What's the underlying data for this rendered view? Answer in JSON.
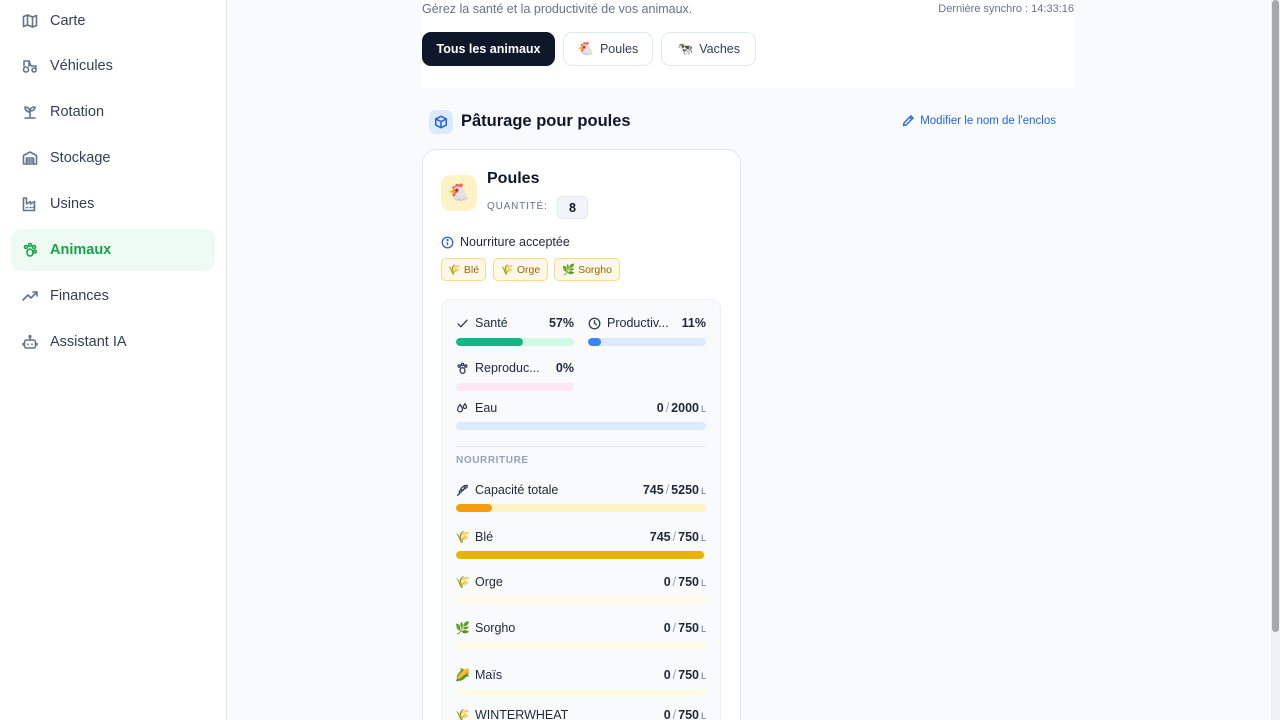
{
  "sidebar": {
    "items": [
      {
        "label": "Carte",
        "icon": "map-icon",
        "active": false
      },
      {
        "label": "Véhicules",
        "icon": "tractor-icon",
        "active": false
      },
      {
        "label": "Rotation",
        "icon": "sprout-icon",
        "active": false
      },
      {
        "label": "Stockage",
        "icon": "warehouse-icon",
        "active": false
      },
      {
        "label": "Usines",
        "icon": "factory-icon",
        "active": false
      },
      {
        "label": "Animaux",
        "icon": "paw-icon",
        "active": true
      },
      {
        "label": "Finances",
        "icon": "trending-up-icon",
        "active": false
      },
      {
        "label": "Assistant IA",
        "icon": "bot-icon",
        "active": false
      }
    ]
  },
  "header": {
    "subtitle": "Gérez la santé et la productivité de vos animaux.",
    "sync": "Dernière synchro : 14:33:16"
  },
  "filters": [
    {
      "label": "Tous les animaux",
      "emoji": "",
      "active": true
    },
    {
      "label": "Poules",
      "emoji": "🐔",
      "active": false
    },
    {
      "label": "Vaches",
      "emoji": "🐄",
      "active": false
    }
  ],
  "section": {
    "title": "Pâturage pour poules",
    "edit_label": "Modifier le nom de l'enclos"
  },
  "card": {
    "avatar": "🐔",
    "name": "Poules",
    "quantity_label": "QUANTITÉ:",
    "quantity": "8",
    "food_title": "Nourriture acceptée",
    "food_tags": [
      {
        "emoji": "🌾",
        "label": "Blé"
      },
      {
        "emoji": "🌾",
        "label": "Orge"
      },
      {
        "emoji": "🌿",
        "label": "Sorgho"
      }
    ],
    "stats": {
      "sante": {
        "label": "Santé",
        "value": "57%",
        "fraction": 0.57,
        "color": "#10b981",
        "track": "#d1fae5"
      },
      "productivite": {
        "label": "Productiv...",
        "value": "11%",
        "fraction": 0.11,
        "color": "#3b82f6",
        "track": "#dbeafe"
      },
      "reproduction": {
        "label": "Reproduc...",
        "value": "0%",
        "fraction": 0.0,
        "color": "#ec4899",
        "track": "#fce7f3"
      },
      "eau": {
        "label": "Eau",
        "current": "0",
        "max": "2000",
        "unit": "L",
        "fraction": 0.0,
        "color": "#3b82f6",
        "track": "#dbeafe"
      }
    },
    "food_section_label": "NOURRITURE",
    "food_rows": [
      {
        "label": "Capacité totale",
        "emoji": "",
        "current": "745",
        "max": "5250",
        "unit": "L",
        "fraction": 0.142,
        "color": "#f59e0b",
        "track": "#fef3c7"
      },
      {
        "label": "Blé",
        "emoji": "🌾",
        "current": "745",
        "max": "750",
        "unit": "L",
        "fraction": 0.993,
        "color": "#eab308",
        "track": "#fef9c3"
      },
      {
        "label": "Orge",
        "emoji": "🌾",
        "current": "0",
        "max": "750",
        "unit": "L",
        "fraction": 0.0,
        "color": "#eab308",
        "track": "#fefce8"
      },
      {
        "label": "Sorgho",
        "emoji": "🌿",
        "current": "0",
        "max": "750",
        "unit": "L",
        "fraction": 0.0,
        "color": "#eab308",
        "track": "#fefce8"
      },
      {
        "label": "Maïs",
        "emoji": "🌽",
        "current": "0",
        "max": "750",
        "unit": "L",
        "fraction": 0.0,
        "color": "#eab308",
        "track": "#fefce8"
      },
      {
        "label": "WINTERWHEAT",
        "emoji": "🌾",
        "current": "0",
        "max": "750",
        "unit": "L",
        "fraction": 0.0,
        "color": "#eab308",
        "track": "#fefce8"
      }
    ]
  }
}
